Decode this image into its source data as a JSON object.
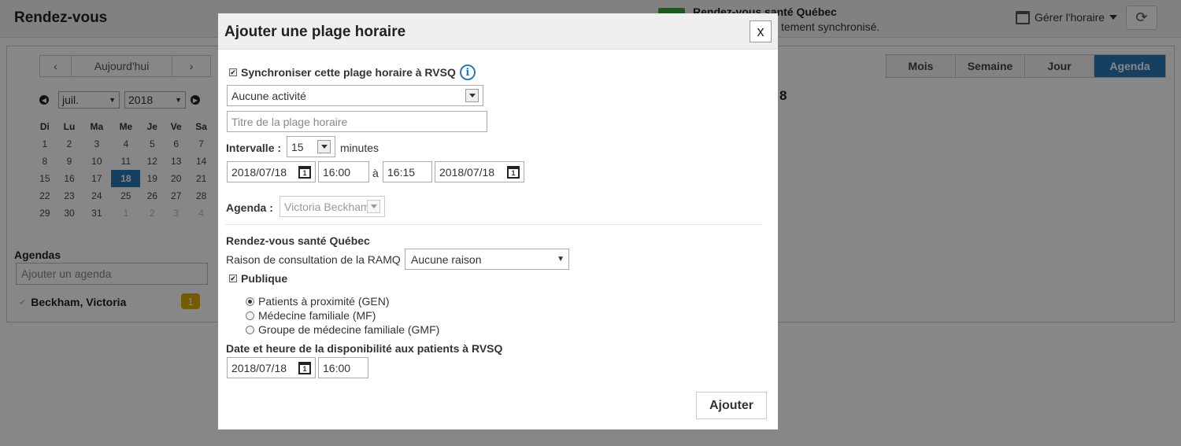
{
  "app": {
    "title": "Rendez-vous",
    "sync_title": "Rendez-vous santé Québec",
    "sync_status": "tement synchronisé.",
    "manage_label": "Gérer l'horaire",
    "refresh_icon": "refresh-icon"
  },
  "calendar": {
    "prev": "‹",
    "today": "Aujourd'hui",
    "next": "›",
    "month": "juil.",
    "year": "2018",
    "weekdays": [
      "Di",
      "Lu",
      "Ma",
      "Me",
      "Je",
      "Ve",
      "Sa"
    ],
    "weeks": [
      [
        "1",
        "2",
        "3",
        "4",
        "5",
        "6",
        "7"
      ],
      [
        "8",
        "9",
        "10",
        "11",
        "12",
        "13",
        "14"
      ],
      [
        "15",
        "16",
        "17",
        "18",
        "19",
        "20",
        "21"
      ],
      [
        "22",
        "23",
        "24",
        "25",
        "26",
        "27",
        "28"
      ],
      [
        "29",
        "30",
        "31",
        "1",
        "2",
        "3",
        "4"
      ]
    ],
    "selected_day": "18"
  },
  "agendas": {
    "label": "Agendas",
    "add_placeholder": "Ajouter un agenda",
    "items": [
      {
        "name": "Beckham, Victoria",
        "count": "1"
      }
    ]
  },
  "views": {
    "tabs": [
      "Mois",
      "Semaine",
      "Jour",
      "Agenda"
    ],
    "active": "Agenda",
    "date_fragment": "8"
  },
  "modal": {
    "title": "Ajouter une plage horaire",
    "close": "x",
    "sync_label": "Synchroniser cette plage horaire à RVSQ",
    "activity": "Aucune activité",
    "title_placeholder": "Titre de la plage horaire",
    "interval_label": "Intervalle :",
    "interval_value": "15",
    "interval_unit": "minutes",
    "start_date": "2018/07/18",
    "start_time": "16:00",
    "to_label": "à",
    "end_time": "16:15",
    "end_date": "2018/07/18",
    "agenda_label": "Agenda :",
    "agenda_value": "Victoria Beckham",
    "rvsq_heading": "Rendez-vous santé Québec",
    "ramq_label": "Raison de consultation de la RAMQ :",
    "ramq_value": "Aucune raison",
    "public_label": "Publique",
    "radios": [
      {
        "label": "Patients à proximité (GEN)",
        "checked": true
      },
      {
        "label": "Médecine familiale (MF)",
        "checked": false
      },
      {
        "label": "Groupe de médecine familiale (GMF)",
        "checked": false
      }
    ],
    "availability_heading": "Date et heure de la disponibilité aux patients à RVSQ",
    "availability_date": "2018/07/18",
    "availability_time": "16:00",
    "submit": "Ajouter",
    "calendar_icon_day": "1"
  }
}
